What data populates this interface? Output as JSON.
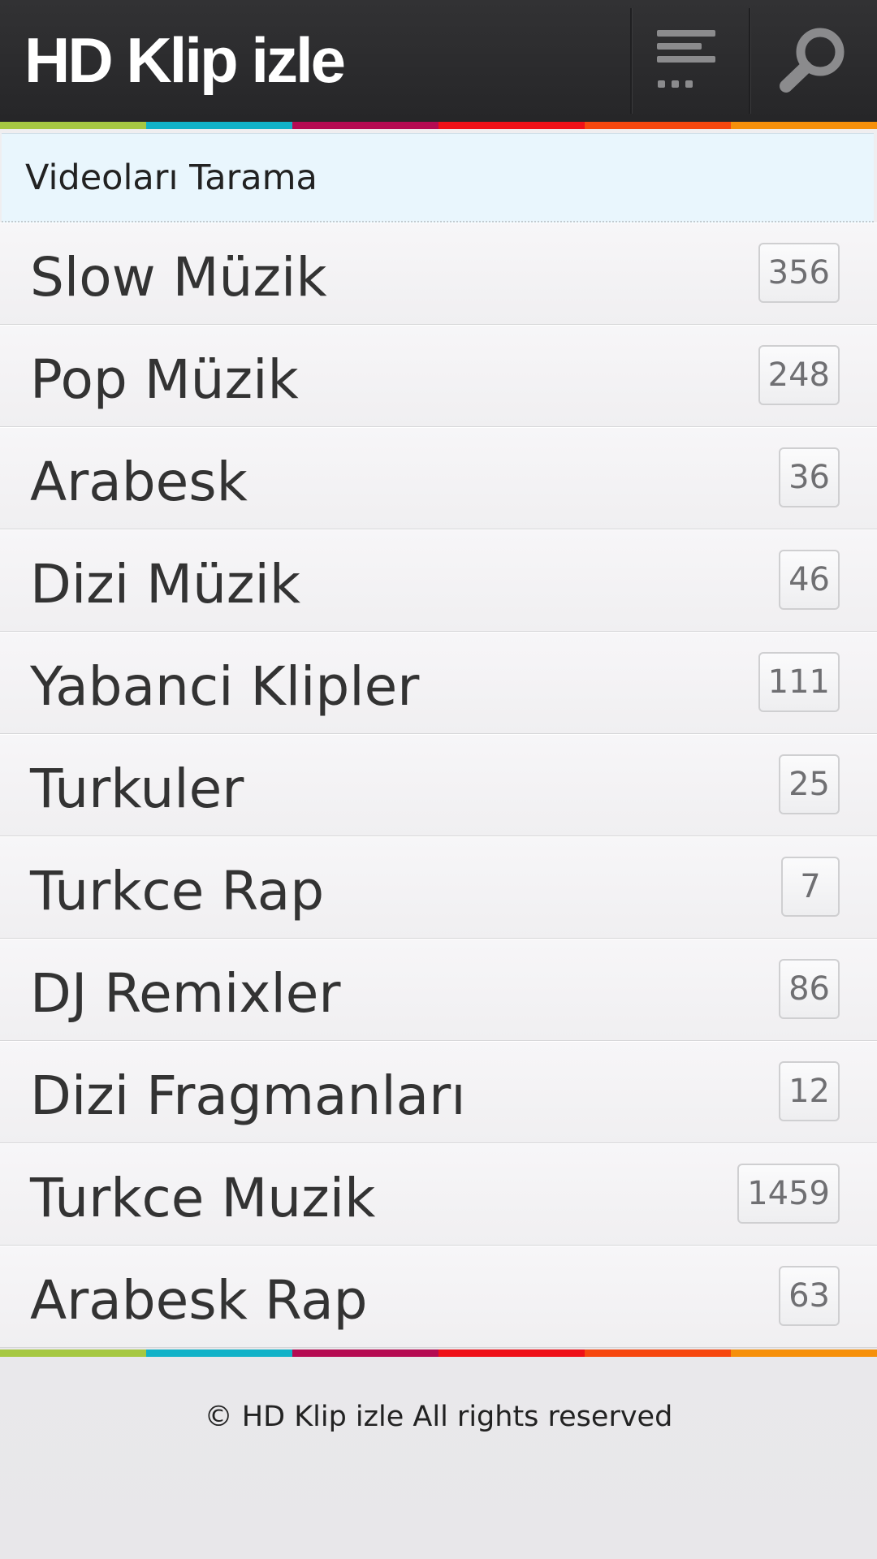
{
  "header": {
    "title": "HD Klip izle",
    "menu_icon": "menu-icon",
    "search_icon": "search-icon"
  },
  "stripe_colors": [
    "#a6c842",
    "#11b2c8",
    "#b50b52",
    "#ef1118",
    "#f6470f",
    "#f6900b"
  ],
  "section": {
    "title": "Videoları Tarama"
  },
  "categories": [
    {
      "label": "Slow Müzik",
      "count": "356"
    },
    {
      "label": "Pop Müzik",
      "count": "248"
    },
    {
      "label": "Arabesk",
      "count": "36"
    },
    {
      "label": "Dizi Müzik",
      "count": "46"
    },
    {
      "label": "Yabanci Klipler",
      "count": "111"
    },
    {
      "label": "Turkuler",
      "count": "25"
    },
    {
      "label": "Turkce Rap",
      "count": "7"
    },
    {
      "label": "DJ Remixler",
      "count": "86"
    },
    {
      "label": "Dizi Fragmanları",
      "count": "12"
    },
    {
      "label": "Turkce Muzik",
      "count": "1459"
    },
    {
      "label": "Arabesk Rap",
      "count": "63"
    }
  ],
  "footer": {
    "text": "© HD Klip izle All rights reserved"
  }
}
